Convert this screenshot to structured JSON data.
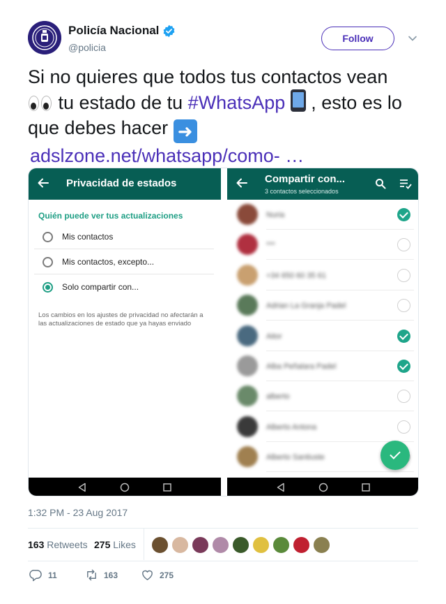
{
  "author": {
    "display_name": "Policía Nacional",
    "handle": "@policia",
    "verified": true,
    "follow_label": "Follow"
  },
  "tweet": {
    "text_part1": "Si no quieres que todos tus contactos vean",
    "text_part2": "tu estado de tu",
    "hashtag": "#WhatsApp",
    "text_part3": ", esto es lo que debes hacer",
    "link": "adslzone.net/whatsapp/como-  …",
    "emojis": [
      "eyes-emoji",
      "mobile-phone-emoji",
      "right-arrow-emoji"
    ]
  },
  "media": {
    "left": {
      "title": "Privacidad de estados",
      "section_label": "Quién puede ver tus actualizaciones",
      "options": [
        {
          "label": "Mis contactos",
          "selected": false
        },
        {
          "label": "Mis contactos, excepto...",
          "selected": false
        },
        {
          "label": "Solo compartir con...",
          "selected": true
        }
      ],
      "note": "Los cambios en los ajustes de privacidad no afectarán a las actualizaciones de estado que ya hayas enviado"
    },
    "right": {
      "title": "Compartir con...",
      "subtitle": "3 contactos seleccionados",
      "contacts": [
        {
          "name": "Nuria",
          "checked": true,
          "color": "#8a4a3a"
        },
        {
          "name": "***",
          "checked": false,
          "color": "#b03040"
        },
        {
          "name": "+34 650 60 35 61",
          "checked": false,
          "color": "#c9a070"
        },
        {
          "name": "Adrian La Granja Padel",
          "checked": false,
          "color": "#5a7a5a"
        },
        {
          "name": "Aitor",
          "checked": true,
          "color": "#4a6a80"
        },
        {
          "name": "Alba Peñalara Padel",
          "checked": true,
          "color": "#9a9a9a"
        },
        {
          "name": "alberto",
          "checked": false,
          "color": "#6a8a6a"
        },
        {
          "name": "Alberto Antona",
          "checked": false,
          "color": "#3a3a3a"
        },
        {
          "name": "Alberto Santiuste",
          "checked": false,
          "color": "#a08050"
        }
      ]
    }
  },
  "timestamp": "1:32 PM - 23 Aug 2017",
  "stats": {
    "retweets_count": "163",
    "retweets_label": "Retweets",
    "likes_count": "275",
    "likes_label": "Likes",
    "liker_colors": [
      "#6b5030",
      "#d8b8a0",
      "#7a3a5a",
      "#b08aa8",
      "#3a5a2a",
      "#e0c040",
      "#5a8a3a",
      "#c02030",
      "#8a8050"
    ]
  },
  "actions": {
    "replies": "11",
    "retweets": "163",
    "likes": "275"
  },
  "colors": {
    "accent": "#4a2fb8",
    "whatsapp_bar": "#075e54",
    "whatsapp_green": "#1ea58a",
    "verified_blue": "#1da1f2"
  }
}
